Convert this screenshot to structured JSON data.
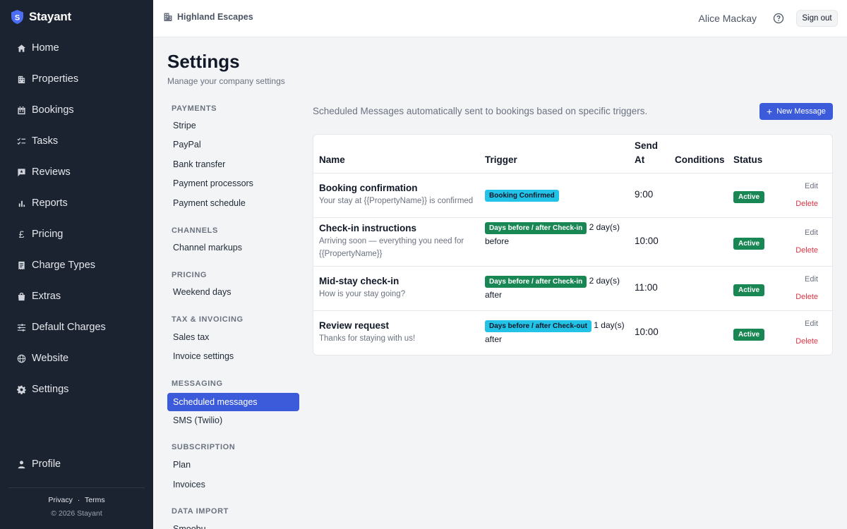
{
  "app": {
    "name": "Stayant"
  },
  "sidebar": {
    "items": [
      {
        "label": "Home",
        "icon": "home-icon"
      },
      {
        "label": "Properties",
        "icon": "building-icon"
      },
      {
        "label": "Bookings",
        "icon": "calendar-icon"
      },
      {
        "label": "Tasks",
        "icon": "checklist-icon"
      },
      {
        "label": "Reviews",
        "icon": "review-icon"
      },
      {
        "label": "Reports",
        "icon": "bar-chart-icon"
      },
      {
        "label": "Pricing",
        "icon": "pound-icon"
      },
      {
        "label": "Charge Types",
        "icon": "receipt-icon"
      },
      {
        "label": "Extras",
        "icon": "bag-icon"
      },
      {
        "label": "Default Charges",
        "icon": "sliders-icon"
      },
      {
        "label": "Website",
        "icon": "globe-icon"
      },
      {
        "label": "Settings",
        "icon": "gear-icon"
      }
    ],
    "profile": {
      "label": "Profile",
      "icon": "person-icon"
    },
    "footer": {
      "privacy": "Privacy",
      "separator": "·",
      "terms": "Terms",
      "copyright": "© 2026 Stayant"
    }
  },
  "topbar": {
    "company": "Highland Escapes",
    "user": "Alice Mackay",
    "signout": "Sign out"
  },
  "page": {
    "title": "Settings",
    "subtitle": "Manage your company settings"
  },
  "settings_nav": {
    "groups": [
      {
        "title": "PAYMENTS",
        "items": [
          "Stripe",
          "PayPal",
          "Bank transfer",
          "Payment processors",
          "Payment schedule"
        ]
      },
      {
        "title": "CHANNELS",
        "items": [
          "Channel markups"
        ]
      },
      {
        "title": "PRICING",
        "items": [
          "Weekend days"
        ]
      },
      {
        "title": "TAX & INVOICING",
        "items": [
          "Sales tax",
          "Invoice settings"
        ]
      },
      {
        "title": "MESSAGING",
        "items": [
          "Scheduled messages",
          "SMS (Twilio)"
        ]
      },
      {
        "title": "SUBSCRIPTION",
        "items": [
          "Plan",
          "Invoices"
        ]
      },
      {
        "title": "DATA IMPORT",
        "items": [
          "Smoobu"
        ]
      }
    ],
    "active": "Scheduled messages"
  },
  "content": {
    "intro": "Scheduled Messages automatically sent to bookings based on specific triggers.",
    "new_button": "New Message",
    "columns": {
      "name": "Name",
      "trigger": "Trigger",
      "send_at_1": "Send",
      "send_at_2": "At",
      "conditions": "Conditions",
      "status": "Status"
    },
    "rows": [
      {
        "name": "Booking confirmation",
        "sub": "Your stay at {{PropertyName}} is confirmed",
        "badge": "Booking Confirmed",
        "trigger_text": "",
        "send_at": "9:00",
        "status": "Active",
        "edit": "Edit",
        "delete": "Delete"
      },
      {
        "name": "Check-in instructions",
        "sub": "Arriving soon — everything you need for {{PropertyName}}",
        "badge": "Days before / after Check-in",
        "trigger_text": "2 day(s) before",
        "send_at": "10:00",
        "status": "Active",
        "edit": "Edit",
        "delete": "Delete"
      },
      {
        "name": "Mid-stay check-in",
        "sub": "How is your stay going?",
        "badge": "Days before / after Check-in",
        "trigger_text": "2 day(s) after",
        "send_at": "11:00",
        "status": "Active",
        "edit": "Edit",
        "delete": "Delete"
      },
      {
        "name": "Review request",
        "sub": "Thanks for staying with us!",
        "badge": "Days before / after Check-out",
        "trigger_text": "1 day(s) after",
        "send_at": "10:00",
        "status": "Active",
        "edit": "Edit",
        "delete": "Delete"
      }
    ]
  },
  "colors": {
    "sidebar_bg": "#1b2331",
    "accent": "#3b5bdb",
    "badge_cyan": "#22c3e6",
    "badge_green": "#198754",
    "delete_red": "#dc3545"
  }
}
